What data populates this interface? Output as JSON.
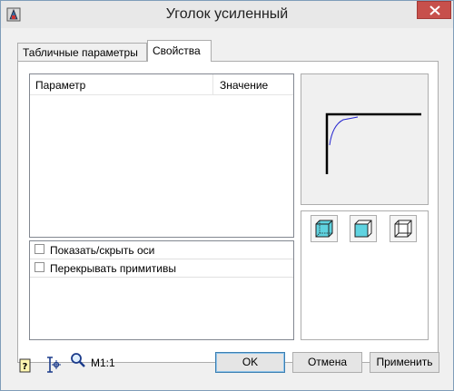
{
  "window": {
    "title": "Уголок усиленный"
  },
  "tabs": [
    {
      "label": "Табличные параметры",
      "active": false
    },
    {
      "label": "Свойства",
      "active": true
    }
  ],
  "grid": {
    "col_param": "Параметр",
    "col_value": "Значение"
  },
  "options": [
    {
      "label": "Показать/скрыть оси",
      "checked": false
    },
    {
      "label": "Перекрывать примитивы",
      "checked": false
    }
  ],
  "footer": {
    "scale": "М1:1",
    "ok_label": "OK",
    "cancel_label": "Отмена",
    "apply_label": "Применить"
  },
  "icons": {
    "app": "app-icon",
    "close": "close-icon",
    "help": "help-icon",
    "snap": "snap-point-icon",
    "zoom": "zoom-icon",
    "view_iso": "view-isometric-icon",
    "view_front": "view-front-icon",
    "view_wire": "view-wireframe-icon"
  },
  "colors": {
    "accent": "#3c7fb1",
    "close": "#c7504b",
    "cube_fill": "#5fd3e0"
  }
}
